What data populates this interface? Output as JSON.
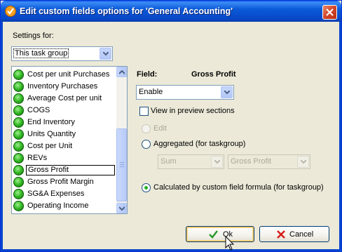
{
  "window": {
    "title": "Edit custom fields options for  'General Accounting'"
  },
  "settings_for": {
    "label": "Settings for:",
    "value": "This task group"
  },
  "fields_list": {
    "items": [
      "Cost per unit Purchases",
      "Inventory Purchases",
      "Average Cost per unit",
      "COGS",
      "End Inventory",
      "Units Quantity",
      "Cost per Unit",
      "REVs",
      "Gross Profit",
      "Gross Profit Margin",
      "SG&A Expenses",
      "Operating Income"
    ],
    "selected": "Gross Profit"
  },
  "field_panel": {
    "field_label": "Field:",
    "field_name": "Gross Profit",
    "mode_value": "Enable",
    "view_in_preview_label": "View in preview sections",
    "edit_label": "Edit",
    "aggregated_label": "Aggregated (for taskgroup)",
    "aggregate_func_value": "Sum",
    "aggregate_field_value": "Gross Profit",
    "calculated_label": "Calculated by custom field formula (for taskgroup)"
  },
  "buttons": {
    "ok_label": "Ok",
    "cancel_label": "Cancel"
  },
  "colors": {
    "titlebar": "#0a5ad8",
    "dialog_bg": "#ece9d8",
    "status_green": "#3cbe2c",
    "cancel_red": "#d8201c",
    "ok_green": "#2a9a2a"
  }
}
